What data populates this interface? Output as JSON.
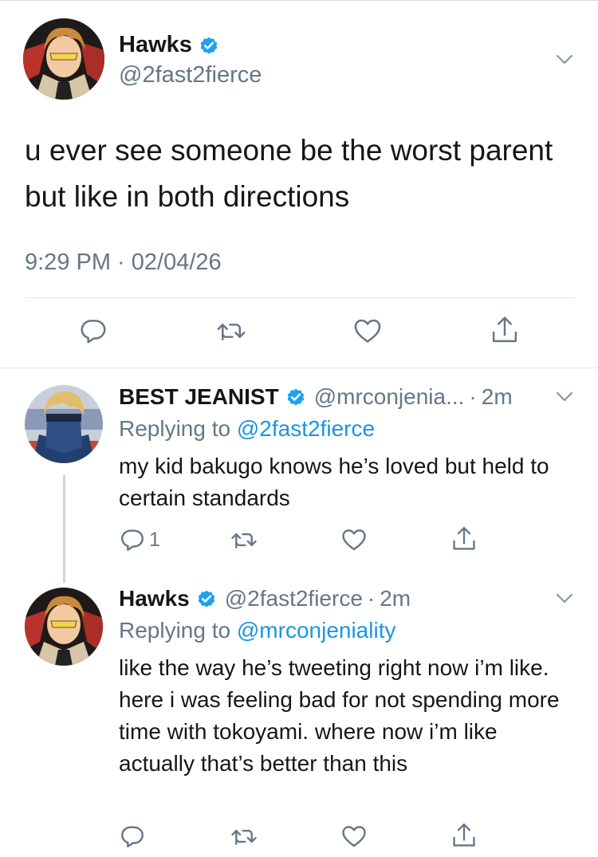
{
  "main_tweet": {
    "author_name": "Hawks",
    "author_handle": "@2fast2fierce",
    "text": "u ever see someone be the worst parent but like in both directions",
    "timestamp": "9:29 PM · 02/04/26",
    "verified": true
  },
  "replies": [
    {
      "author_name": "BEST JEANIST",
      "author_handle": "@mrconjenia...",
      "separator": "·",
      "time_ago": "2m",
      "replying_prefix": "Replying to ",
      "replying_to": "@2fast2fierce",
      "text": "my kid bakugo knows he’s loved but held to certain standards",
      "reply_count": "1",
      "verified": true
    },
    {
      "author_name": "Hawks",
      "author_handle": "@2fast2fierce",
      "separator": "·",
      "time_ago": "2m",
      "replying_prefix": "Replying to ",
      "replying_to": "@mrconjeniality",
      "text": "like the way he’s tweeting right now i’m like. here i was feeling bad for not spending more time with tokoyami. where now i’m like actually that’s better than this",
      "reply_count": "",
      "verified": true
    }
  ],
  "icons": [
    "reply-icon",
    "retweet-icon",
    "like-icon",
    "share-icon",
    "verified-badge-icon",
    "chevron-down-icon"
  ],
  "colors": {
    "text": "#14171a",
    "secondary": "#657786",
    "link": "#1b95e0",
    "verified": "#1da1f2"
  }
}
